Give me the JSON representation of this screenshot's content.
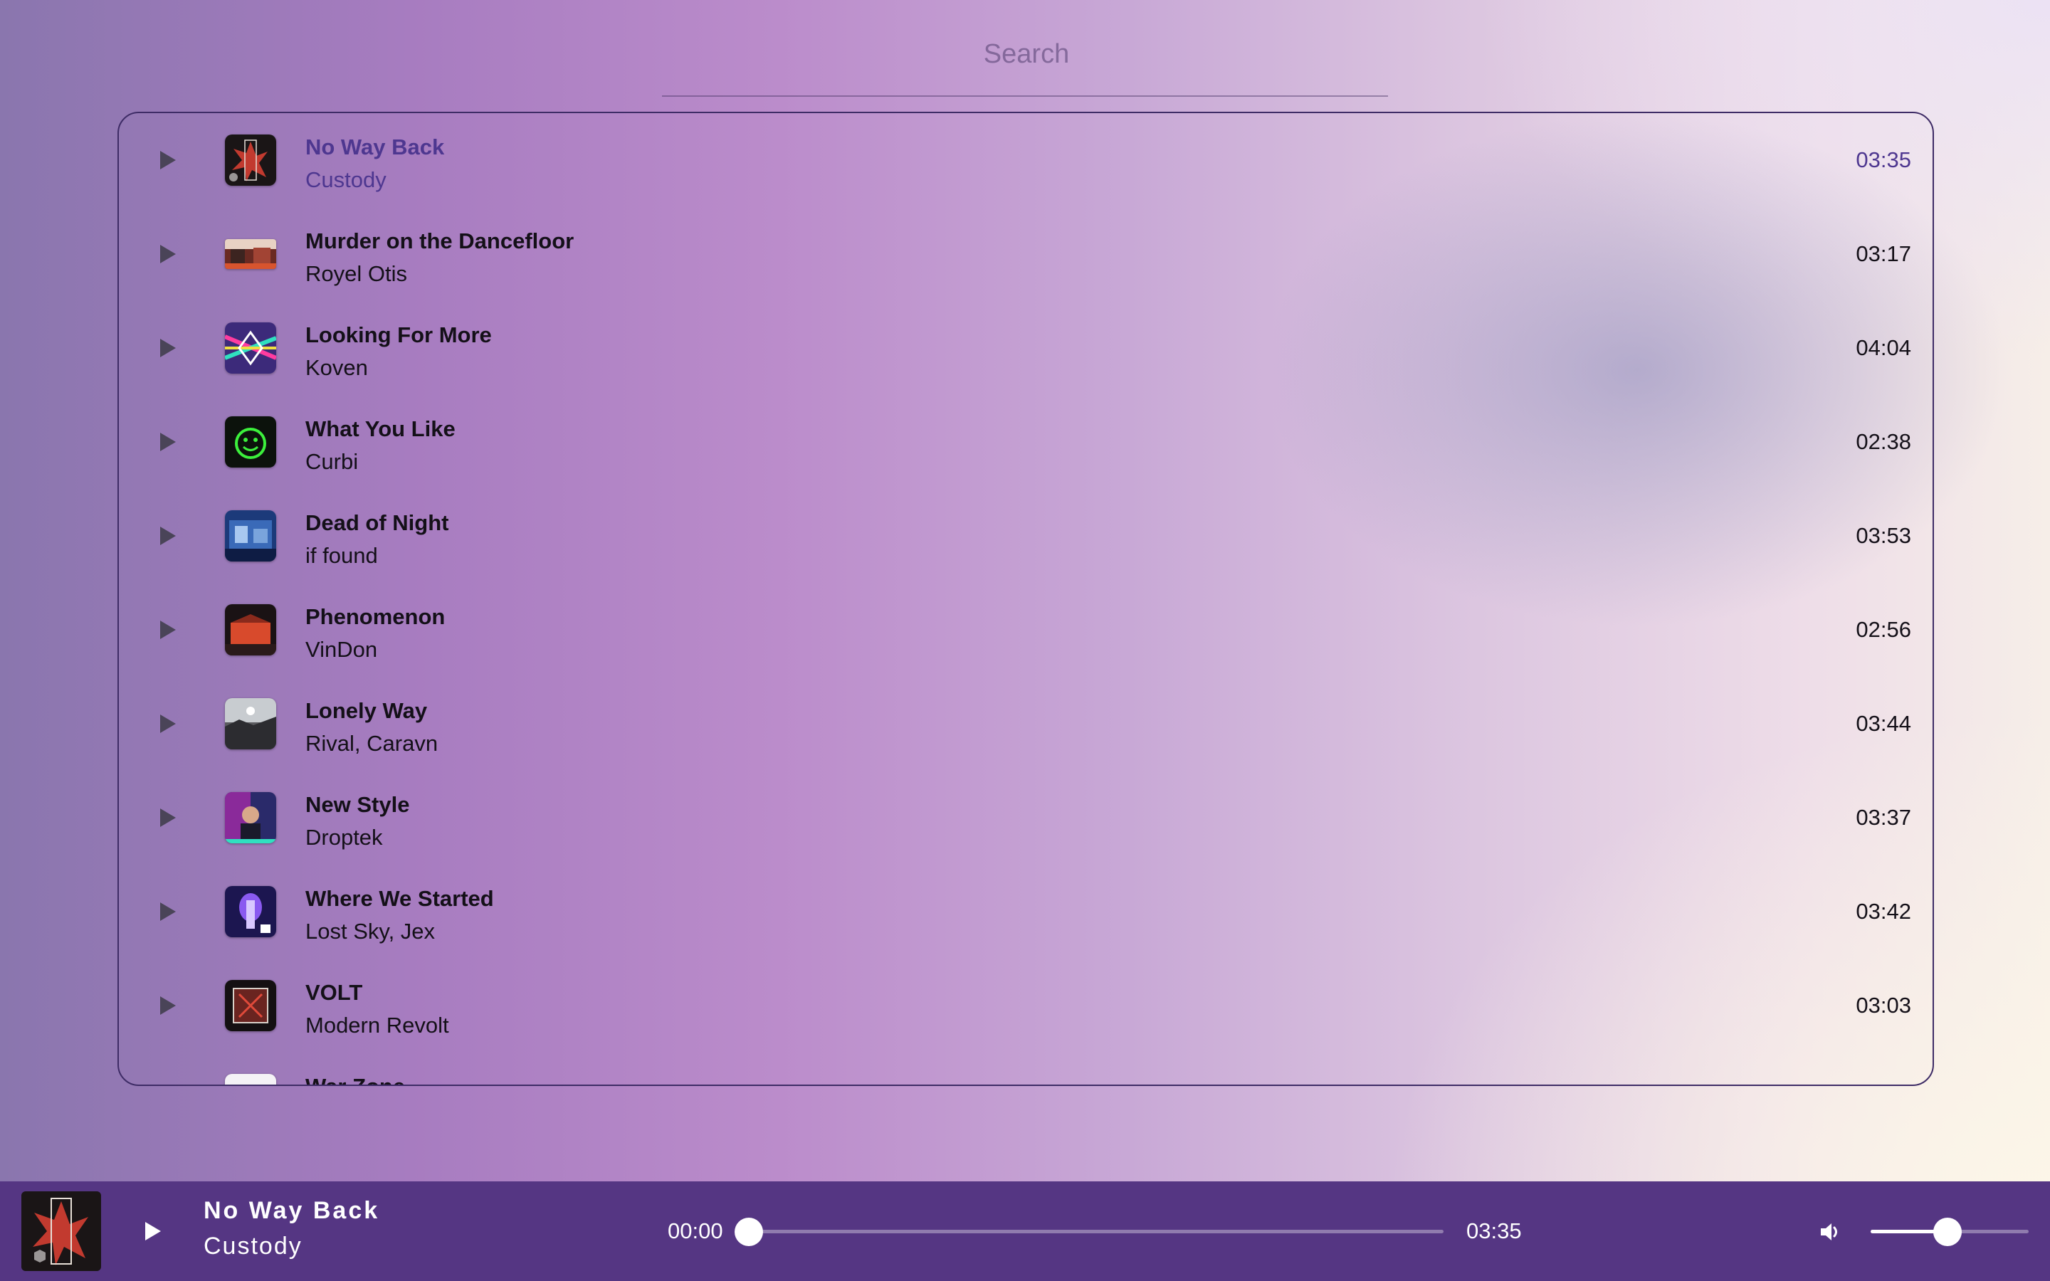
{
  "search": {
    "placeholder": "Search",
    "value": ""
  },
  "tracks": [
    {
      "title": "No Way Back",
      "artist": "Custody",
      "duration": "03:35",
      "active": true,
      "cover": "art-red-black"
    },
    {
      "title": "Murder on the Dancefloor",
      "artist": "Royel Otis",
      "duration": "03:17",
      "active": false,
      "cover": "art-red-photo"
    },
    {
      "title": "Looking For More",
      "artist": "Koven",
      "duration": "04:04",
      "active": false,
      "cover": "art-neon-diamond"
    },
    {
      "title": "What You Like",
      "artist": "Curbi",
      "duration": "02:38",
      "active": false,
      "cover": "art-green-smiley"
    },
    {
      "title": "Dead of Night",
      "artist": "if found",
      "duration": "03:53",
      "active": false,
      "cover": "art-blue-city"
    },
    {
      "title": "Phenomenon",
      "artist": "VinDon",
      "duration": "02:56",
      "active": false,
      "cover": "art-red-stage"
    },
    {
      "title": "Lonely Way",
      "artist": "Rival, Caravn",
      "duration": "03:44",
      "active": false,
      "cover": "art-grey-sky"
    },
    {
      "title": "New Style",
      "artist": "Droptek",
      "duration": "03:37",
      "active": false,
      "cover": "art-teal-portrait"
    },
    {
      "title": "Where We Started",
      "artist": "Lost Sky, Jex",
      "duration": "03:42",
      "active": false,
      "cover": "art-purple-figure"
    },
    {
      "title": "VOLT",
      "artist": "Modern Revolt",
      "duration": "03:03",
      "active": false,
      "cover": "art-dark-red-frame"
    },
    {
      "title": "War Zone",
      "artist": "",
      "duration": "",
      "active": false,
      "cover": "art-white"
    }
  ],
  "player": {
    "title": "No Way Back",
    "artist": "Custody",
    "current_time": "00:00",
    "total_time": "03:35",
    "progress": 0,
    "volume": 0.5,
    "cover": "art-red-black"
  },
  "icons": {
    "play": "play-icon",
    "volume": "volume-icon"
  },
  "colors": {
    "accent": "#553683",
    "active_text": "#4e3790",
    "border": "#3e2c66"
  }
}
